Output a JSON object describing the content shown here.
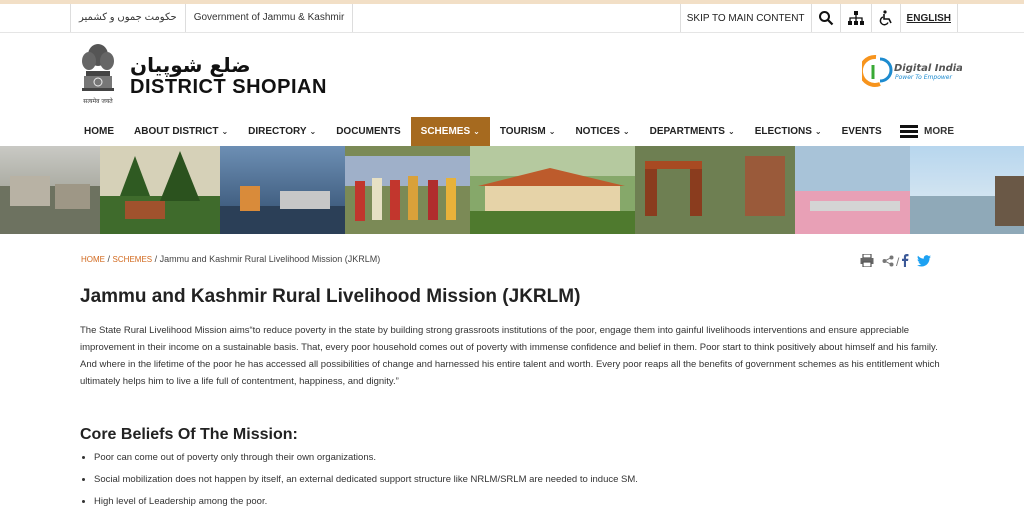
{
  "topbar": {
    "urdu_gov": "حکومت جموں و کشمیر",
    "english_gov": "Government of Jammu & Kashmir",
    "skip": "SKIP TO MAIN CONTENT",
    "language": "ENGLISH"
  },
  "header": {
    "urdu_title": "ضلع شوپیان",
    "title": "DISTRICT SHOPIAN",
    "emblem_caption": "सत्यमेव जयते",
    "digital_india_title": "Digital India",
    "digital_india_tagline": "Power To Empower"
  },
  "nav": {
    "items": [
      {
        "label": "HOME",
        "dropdown": false
      },
      {
        "label": "ABOUT DISTRICT",
        "dropdown": true
      },
      {
        "label": "DIRECTORY",
        "dropdown": true
      },
      {
        "label": "DOCUMENTS",
        "dropdown": false
      },
      {
        "label": "SCHEMES",
        "dropdown": true
      },
      {
        "label": "TOURISM",
        "dropdown": true
      },
      {
        "label": "NOTICES",
        "dropdown": true
      },
      {
        "label": "DEPARTMENTS",
        "dropdown": true
      },
      {
        "label": "ELECTIONS",
        "dropdown": true
      },
      {
        "label": "EVENTS",
        "dropdown": false
      }
    ],
    "more_label": "MORE"
  },
  "breadcrumb": {
    "home": "HOME",
    "schemes": "SCHEMES",
    "current": "Jammu and Kashmir Rural Livelihood Mission (JKRLM)"
  },
  "main": {
    "title": "Jammu and Kashmir Rural Livelihood Mission (JKRLM)",
    "paragraph": "The State Rural Livelihood Mission aims“to reduce poverty in the state by building strong grassroots institutions of the poor, engage them into gainful livelihoods interventions and ensure appreciable improvement in their income on a sustainable basis. That, every poor household comes out of poverty with immense confidence and belief in them. Poor start to think positively about himself and his family. And where in the lifetime of the poor he has accessed all possibilities of change and harnessed his entire talent and worth. Every poor reaps all the benefits of government schemes as his entitlement which ultimately helps him to live a life full of contentment, happiness, and dignity.”",
    "core_title": "Core Beliefs Of The Mission:",
    "beliefs": [
      "Poor can come out of poverty only through their own organizations.",
      "Social mobilization does not happen by itself, an external dedicated support structure like NRLM/SRLM are needed to induce SM.",
      "High level of Leadership among the poor."
    ]
  },
  "colors": {
    "active_nav": "#a66a1f",
    "breadcrumb_link": "#d2691e",
    "facebook": "#3b5998",
    "twitter": "#1da1f2"
  }
}
